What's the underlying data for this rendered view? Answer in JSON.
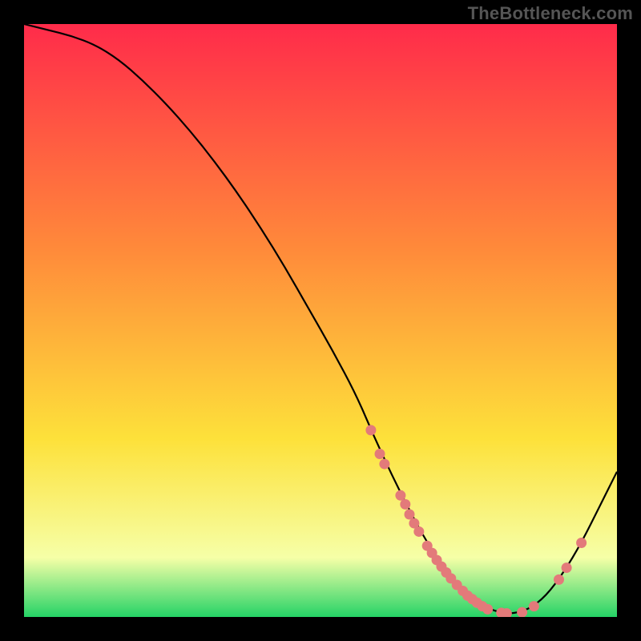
{
  "watermark": "TheBottleneck.com",
  "colors": {
    "gradient_top": "#FF2B4A",
    "gradient_mid1": "#FF8A3A",
    "gradient_mid2": "#FDE13A",
    "gradient_mid3": "#F6FFA7",
    "gradient_bottom": "#25D366",
    "curve_stroke": "#000000",
    "scatter_fill": "#E37A7A",
    "frame_bg": "#000000"
  },
  "chart_data": {
    "type": "line",
    "title": "",
    "xlabel": "",
    "ylabel": "",
    "xlim": [
      0,
      100
    ],
    "ylim": [
      0,
      100
    ],
    "series": [
      {
        "name": "bottleneck-curve",
        "x": [
          0,
          4,
          8,
          12,
          16,
          20,
          24,
          28,
          32,
          36,
          40,
          44,
          48,
          52,
          56,
          59,
          62,
          65,
          68,
          71,
          74,
          77,
          80,
          82,
          85,
          88,
          91,
          94,
          97,
          100
        ],
        "y": [
          100,
          99,
          98,
          96.5,
          94,
          90.5,
          86.5,
          82,
          77,
          71.5,
          65.5,
          59,
          52,
          45,
          37.5,
          30.5,
          24,
          18,
          12.5,
          8,
          4.5,
          2,
          0.8,
          0.5,
          1.2,
          3.5,
          7.5,
          12.5,
          18.5,
          24.5
        ]
      }
    ],
    "scatter": {
      "name": "measurement-dots",
      "points": [
        {
          "x": 58.5,
          "y": 31.5
        },
        {
          "x": 60.0,
          "y": 27.5
        },
        {
          "x": 60.8,
          "y": 25.8
        },
        {
          "x": 63.5,
          "y": 20.5
        },
        {
          "x": 64.3,
          "y": 19.0
        },
        {
          "x": 65.0,
          "y": 17.3
        },
        {
          "x": 65.8,
          "y": 15.8
        },
        {
          "x": 66.6,
          "y": 14.4
        },
        {
          "x": 68.0,
          "y": 12.0
        },
        {
          "x": 68.8,
          "y": 10.8
        },
        {
          "x": 69.6,
          "y": 9.6
        },
        {
          "x": 70.4,
          "y": 8.5
        },
        {
          "x": 71.2,
          "y": 7.5
        },
        {
          "x": 72.0,
          "y": 6.5
        },
        {
          "x": 73.0,
          "y": 5.4
        },
        {
          "x": 74.0,
          "y": 4.4
        },
        {
          "x": 74.8,
          "y": 3.6
        },
        {
          "x": 75.6,
          "y": 3.0
        },
        {
          "x": 76.4,
          "y": 2.4
        },
        {
          "x": 77.3,
          "y": 1.8
        },
        {
          "x": 78.2,
          "y": 1.3
        },
        {
          "x": 80.5,
          "y": 0.7
        },
        {
          "x": 81.4,
          "y": 0.6
        },
        {
          "x": 84.0,
          "y": 0.8
        },
        {
          "x": 86.0,
          "y": 1.8
        },
        {
          "x": 90.2,
          "y": 6.3
        },
        {
          "x": 91.5,
          "y": 8.3
        },
        {
          "x": 94.0,
          "y": 12.5
        }
      ]
    }
  }
}
